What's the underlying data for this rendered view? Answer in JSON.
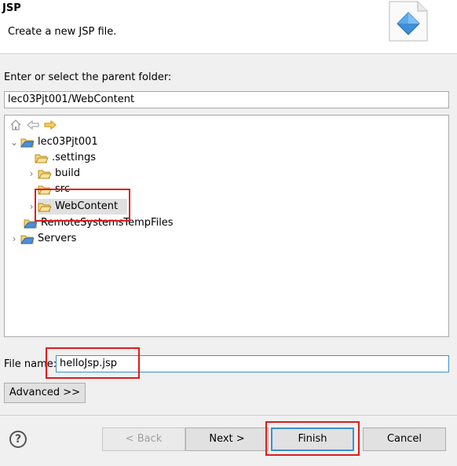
{
  "header": {
    "title": "JSP",
    "description": "Create a new JSP file.",
    "icon": "jsp-wizard-icon"
  },
  "parent_folder": {
    "label": "Enter or select the parent folder:",
    "value": "lec03Pjt001/WebContent"
  },
  "tree": {
    "toolbar": [
      "home-icon",
      "back-arrow-icon",
      "forward-arrow-icon"
    ],
    "items": [
      {
        "label": "lec03Pjt001",
        "twisty": "expanded",
        "icon": "project-icon"
      },
      {
        "label": ".settings",
        "twisty": "none",
        "icon": "folder-icon"
      },
      {
        "label": "build",
        "twisty": "collapsed",
        "icon": "folder-icon"
      },
      {
        "label": "src",
        "twisty": "none",
        "icon": "folder-icon"
      },
      {
        "label": "WebContent",
        "twisty": "collapsed",
        "icon": "folder-icon",
        "selected": true
      },
      {
        "label": "RemoteSystemsTempFiles",
        "twisty": "none",
        "icon": "project-icon"
      },
      {
        "label": "Servers",
        "twisty": "collapsed",
        "icon": "project-icon"
      }
    ]
  },
  "file_name": {
    "label": "File name:",
    "value": "helloJsp.jsp"
  },
  "advanced_button": "Advanced >>",
  "buttons": {
    "back": "< Back",
    "next": "Next >",
    "finish": "Finish",
    "cancel": "Cancel"
  },
  "colors": {
    "highlight_box": "#e11a1a",
    "focus_border": "#3c8fd5"
  }
}
